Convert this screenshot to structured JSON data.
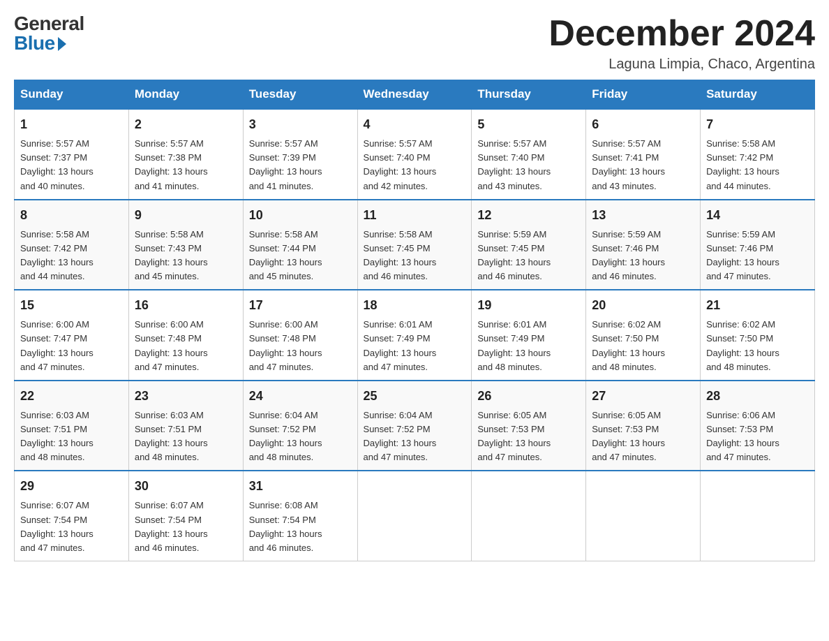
{
  "header": {
    "logo_general": "General",
    "logo_blue": "Blue",
    "month_year": "December 2024",
    "location": "Laguna Limpia, Chaco, Argentina"
  },
  "weekdays": [
    "Sunday",
    "Monday",
    "Tuesday",
    "Wednesday",
    "Thursday",
    "Friday",
    "Saturday"
  ],
  "weeks": [
    [
      {
        "day": "1",
        "sunrise": "5:57 AM",
        "sunset": "7:37 PM",
        "daylight": "13 hours and 40 minutes."
      },
      {
        "day": "2",
        "sunrise": "5:57 AM",
        "sunset": "7:38 PM",
        "daylight": "13 hours and 41 minutes."
      },
      {
        "day": "3",
        "sunrise": "5:57 AM",
        "sunset": "7:39 PM",
        "daylight": "13 hours and 41 minutes."
      },
      {
        "day": "4",
        "sunrise": "5:57 AM",
        "sunset": "7:40 PM",
        "daylight": "13 hours and 42 minutes."
      },
      {
        "day": "5",
        "sunrise": "5:57 AM",
        "sunset": "7:40 PM",
        "daylight": "13 hours and 43 minutes."
      },
      {
        "day": "6",
        "sunrise": "5:57 AM",
        "sunset": "7:41 PM",
        "daylight": "13 hours and 43 minutes."
      },
      {
        "day": "7",
        "sunrise": "5:58 AM",
        "sunset": "7:42 PM",
        "daylight": "13 hours and 44 minutes."
      }
    ],
    [
      {
        "day": "8",
        "sunrise": "5:58 AM",
        "sunset": "7:42 PM",
        "daylight": "13 hours and 44 minutes."
      },
      {
        "day": "9",
        "sunrise": "5:58 AM",
        "sunset": "7:43 PM",
        "daylight": "13 hours and 45 minutes."
      },
      {
        "day": "10",
        "sunrise": "5:58 AM",
        "sunset": "7:44 PM",
        "daylight": "13 hours and 45 minutes."
      },
      {
        "day": "11",
        "sunrise": "5:58 AM",
        "sunset": "7:45 PM",
        "daylight": "13 hours and 46 minutes."
      },
      {
        "day": "12",
        "sunrise": "5:59 AM",
        "sunset": "7:45 PM",
        "daylight": "13 hours and 46 minutes."
      },
      {
        "day": "13",
        "sunrise": "5:59 AM",
        "sunset": "7:46 PM",
        "daylight": "13 hours and 46 minutes."
      },
      {
        "day": "14",
        "sunrise": "5:59 AM",
        "sunset": "7:46 PM",
        "daylight": "13 hours and 47 minutes."
      }
    ],
    [
      {
        "day": "15",
        "sunrise": "6:00 AM",
        "sunset": "7:47 PM",
        "daylight": "13 hours and 47 minutes."
      },
      {
        "day": "16",
        "sunrise": "6:00 AM",
        "sunset": "7:48 PM",
        "daylight": "13 hours and 47 minutes."
      },
      {
        "day": "17",
        "sunrise": "6:00 AM",
        "sunset": "7:48 PM",
        "daylight": "13 hours and 47 minutes."
      },
      {
        "day": "18",
        "sunrise": "6:01 AM",
        "sunset": "7:49 PM",
        "daylight": "13 hours and 47 minutes."
      },
      {
        "day": "19",
        "sunrise": "6:01 AM",
        "sunset": "7:49 PM",
        "daylight": "13 hours and 48 minutes."
      },
      {
        "day": "20",
        "sunrise": "6:02 AM",
        "sunset": "7:50 PM",
        "daylight": "13 hours and 48 minutes."
      },
      {
        "day": "21",
        "sunrise": "6:02 AM",
        "sunset": "7:50 PM",
        "daylight": "13 hours and 48 minutes."
      }
    ],
    [
      {
        "day": "22",
        "sunrise": "6:03 AM",
        "sunset": "7:51 PM",
        "daylight": "13 hours and 48 minutes."
      },
      {
        "day": "23",
        "sunrise": "6:03 AM",
        "sunset": "7:51 PM",
        "daylight": "13 hours and 48 minutes."
      },
      {
        "day": "24",
        "sunrise": "6:04 AM",
        "sunset": "7:52 PM",
        "daylight": "13 hours and 48 minutes."
      },
      {
        "day": "25",
        "sunrise": "6:04 AM",
        "sunset": "7:52 PM",
        "daylight": "13 hours and 47 minutes."
      },
      {
        "day": "26",
        "sunrise": "6:05 AM",
        "sunset": "7:53 PM",
        "daylight": "13 hours and 47 minutes."
      },
      {
        "day": "27",
        "sunrise": "6:05 AM",
        "sunset": "7:53 PM",
        "daylight": "13 hours and 47 minutes."
      },
      {
        "day": "28",
        "sunrise": "6:06 AM",
        "sunset": "7:53 PM",
        "daylight": "13 hours and 47 minutes."
      }
    ],
    [
      {
        "day": "29",
        "sunrise": "6:07 AM",
        "sunset": "7:54 PM",
        "daylight": "13 hours and 47 minutes."
      },
      {
        "day": "30",
        "sunrise": "6:07 AM",
        "sunset": "7:54 PM",
        "daylight": "13 hours and 46 minutes."
      },
      {
        "day": "31",
        "sunrise": "6:08 AM",
        "sunset": "7:54 PM",
        "daylight": "13 hours and 46 minutes."
      },
      null,
      null,
      null,
      null
    ]
  ],
  "labels": {
    "sunrise": "Sunrise:",
    "sunset": "Sunset:",
    "daylight": "Daylight:"
  }
}
